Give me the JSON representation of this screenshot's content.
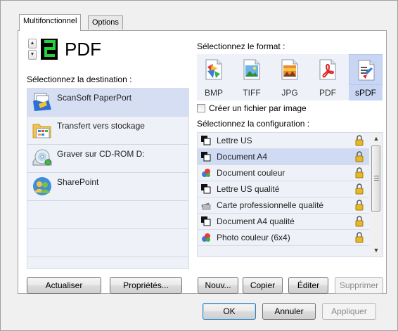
{
  "tabs": [
    {
      "label": "Multifonctionnel",
      "active": true
    },
    {
      "label": "Options",
      "active": false
    }
  ],
  "format_display": {
    "digit": "2",
    "format": "PDF"
  },
  "destination": {
    "label": "Sélectionnez la destination :",
    "items": [
      {
        "name": "ScanSoft PaperPort",
        "icon": "paperport-icon",
        "selected": true
      },
      {
        "name": "Transfert vers stockage",
        "icon": "storage-folder-icon",
        "selected": false
      },
      {
        "name": "Graver sur CD-ROM  D:",
        "icon": "cd-burn-icon",
        "selected": false
      },
      {
        "name": "SharePoint",
        "icon": "sharepoint-icon",
        "selected": false
      }
    ],
    "refresh_label": "Actualiser",
    "properties_label": "Propriétés..."
  },
  "format": {
    "label": "Sélectionnez le format :",
    "items": [
      {
        "name": "BMP",
        "icon": "bmp-icon",
        "selected": false
      },
      {
        "name": "TIFF",
        "icon": "tiff-icon",
        "selected": false
      },
      {
        "name": "JPG",
        "icon": "jpg-icon",
        "selected": false
      },
      {
        "name": "PDF",
        "icon": "pdf-icon",
        "selected": false
      },
      {
        "name": "sPDF",
        "icon": "spdf-icon",
        "selected": true
      }
    ],
    "one_file_per_image_label": "Créer un fichier par image",
    "one_file_per_image_checked": false
  },
  "configuration": {
    "label": "Sélectionnez la configuration :",
    "items": [
      {
        "name": "Lettre US",
        "icon": "bw-document-icon",
        "selected": false
      },
      {
        "name": "Document A4",
        "icon": "bw-document-icon",
        "selected": true
      },
      {
        "name": "Document couleur",
        "icon": "color-document-icon",
        "selected": false
      },
      {
        "name": "Lettre US qualité",
        "icon": "bw-document-icon",
        "selected": false
      },
      {
        "name": "Carte professionnelle qualité",
        "icon": "business-card-icon",
        "selected": false
      },
      {
        "name": "Document A4 qualité",
        "icon": "bw-document-icon",
        "selected": false
      },
      {
        "name": "Photo couleur (6x4)",
        "icon": "color-document-icon",
        "selected": false
      }
    ],
    "new_label": "Nouv...",
    "copy_label": "Copier",
    "edit_label": "Éditer",
    "delete_label": "Supprimer"
  },
  "footer": {
    "ok_label": "OK",
    "cancel_label": "Annuler",
    "apply_label": "Appliquer"
  },
  "colors": {
    "list_background": "#eef2f8",
    "selection": "#d5def3",
    "digit_green": "#22d33a",
    "lock_gold": "#e8b828"
  }
}
